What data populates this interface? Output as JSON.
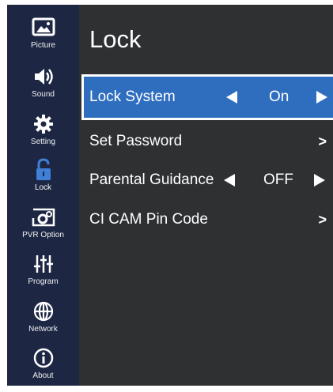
{
  "sidebar": {
    "items": [
      {
        "label": "Picture",
        "icon": "picture-icon"
      },
      {
        "label": "Sound",
        "icon": "speaker-icon"
      },
      {
        "label": "Setting",
        "icon": "gear-icon"
      },
      {
        "label": "Lock",
        "icon": "lock-open-icon",
        "active": true
      },
      {
        "label": "PVR Option",
        "icon": "pvr-gear-icon"
      },
      {
        "label": "Program",
        "icon": "sliders-icon"
      },
      {
        "label": "Network",
        "icon": "globe-icon"
      },
      {
        "label": "About",
        "icon": "info-icon"
      }
    ]
  },
  "main": {
    "title": "Lock",
    "rows": [
      {
        "label": "Lock System",
        "value": "On",
        "type": "selector",
        "selected": true
      },
      {
        "label": "Set Password",
        "type": "submenu",
        "chevron": ">"
      },
      {
        "label": "Parental Guidance",
        "value": "OFF",
        "type": "selector"
      },
      {
        "label": "CI CAM Pin Code",
        "type": "submenu",
        "chevron": ">"
      }
    ]
  },
  "colors": {
    "sidebar_bg": "#1d2744",
    "content_bg": "#2e3032",
    "selection": "#2f6ebf",
    "lock_icon": "#3f7fd6"
  }
}
